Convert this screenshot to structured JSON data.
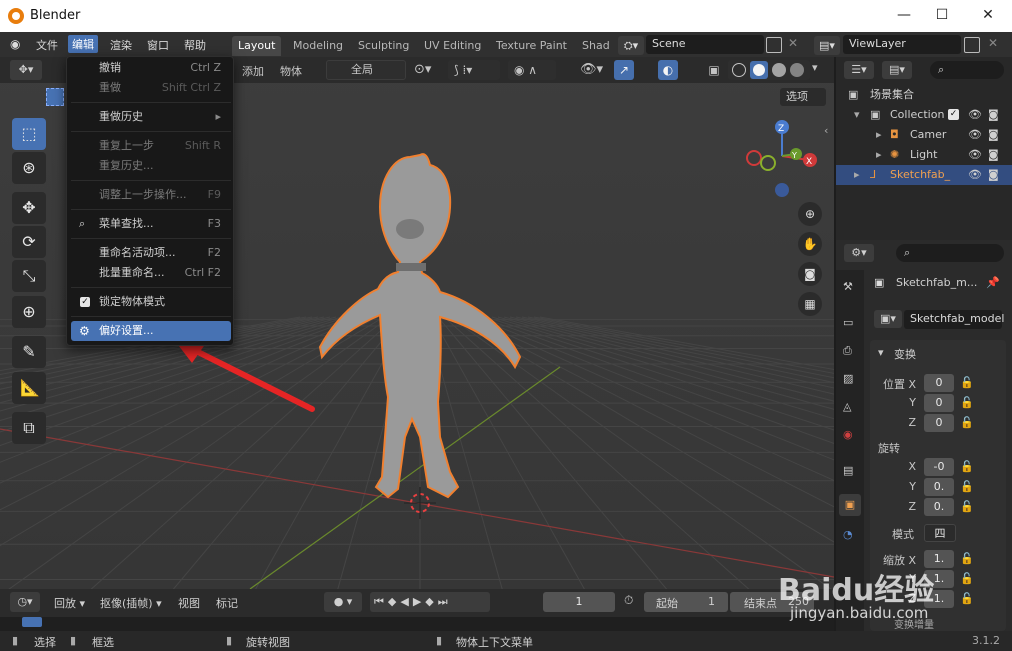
{
  "window": {
    "title": "Blender",
    "controls": [
      "—",
      "☐",
      "✕"
    ]
  },
  "menubar": {
    "items": [
      "文件",
      "编辑",
      "渲染",
      "窗口",
      "帮助"
    ],
    "active_index": 1,
    "workspaces": [
      "Layout",
      "Modeling",
      "Sculpting",
      "UV Editing",
      "Texture Paint",
      "Shad"
    ],
    "active_workspace": "Layout",
    "scene": "Scene",
    "view_layer": "ViewLayer"
  },
  "viewport_header": {
    "add": "添加",
    "object": "物体",
    "orientation": "全局",
    "options": "选项"
  },
  "edit_menu": {
    "items": [
      {
        "label": "撤销",
        "shortcut": "Ctrl Z",
        "disabled": false
      },
      {
        "label": "重做",
        "shortcut": "Shift Ctrl Z",
        "disabled": true
      },
      {
        "label": "重做历史",
        "shortcut": "▸",
        "disabled": false
      },
      {
        "label": "重复上一步",
        "shortcut": "Shift R",
        "disabled": true
      },
      {
        "label": "重复历史...",
        "shortcut": "",
        "disabled": true
      },
      {
        "label": "调整上一步操作...",
        "shortcut": "F9",
        "disabled": true
      },
      {
        "label": "菜单查找...",
        "shortcut": "F3",
        "disabled": false
      },
      {
        "label": "重命名活动项...",
        "shortcut": "F2",
        "disabled": false
      },
      {
        "label": "批量重命名...",
        "shortcut": "Ctrl F2",
        "disabled": false
      },
      {
        "label": "锁定物体模式",
        "shortcut": "",
        "disabled": false
      },
      {
        "label": "偏好设置...",
        "shortcut": "",
        "disabled": false
      }
    ]
  },
  "outliner": {
    "root": "场景集合",
    "collection": "Collection",
    "items": [
      "Camer",
      "Light",
      "Sketchfab_"
    ]
  },
  "properties": {
    "object_name": "Sketchfab_m...",
    "data_name": "Sketchfab_model",
    "section": "变换",
    "location_label": "位置 X",
    "rotation_label": "旋转",
    "scale_label": "缩放 X",
    "mode_label": "模式",
    "mode_value": "四",
    "axes": [
      "Y",
      "Z",
      "X",
      "Y",
      "Z",
      "Y",
      "Z"
    ],
    "location": [
      "0",
      "0",
      "0"
    ],
    "rotation": [
      "-0",
      "0.",
      "0."
    ],
    "scale": [
      "1.",
      "1.",
      "1."
    ],
    "section_bottom": "变换增量"
  },
  "timeline": {
    "playback": "回放",
    "keying": "抠像(插帧)",
    "view": "视图",
    "marker": "标记",
    "current_frame": "1",
    "start_label": "起始",
    "start": "1",
    "end_label": "结束点",
    "end": "250"
  },
  "statusbar": {
    "select": "选择",
    "box_select": "框选",
    "rotate": "旋转视图",
    "context": "物体上下文菜单",
    "version": "3.1.2"
  },
  "watermark": {
    "text": "Baidu经验",
    "url": "jingyan.baidu.com"
  },
  "colors": {
    "accent": "#4772b3",
    "selection_outline": "#f08030",
    "arrow": "#e52525"
  }
}
